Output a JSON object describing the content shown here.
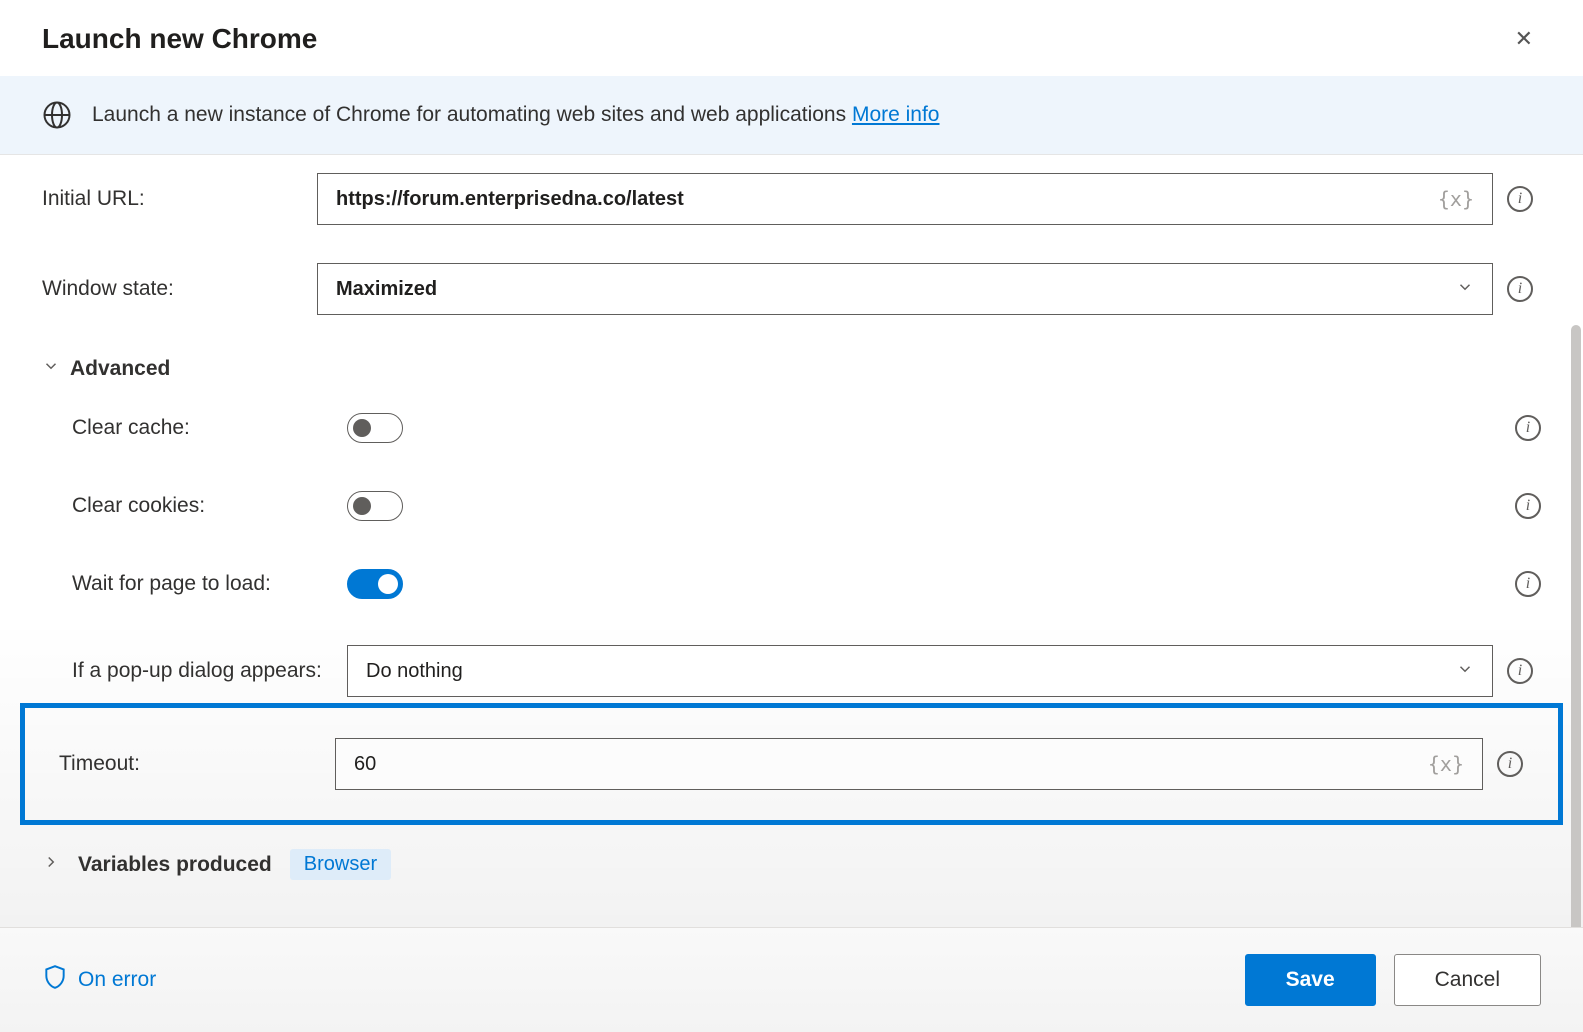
{
  "dialog": {
    "title": "Launch new Chrome",
    "close_tooltip": "Close"
  },
  "banner": {
    "text": "Launch a new instance of Chrome for automating web sites and web applications ",
    "link": "More info"
  },
  "fields": {
    "initial_url": {
      "label": "Initial URL:",
      "value": "https://forum.enterprisedna.co/latest"
    },
    "window_state": {
      "label": "Window state:",
      "value": "Maximized"
    },
    "advanced_header": "Advanced",
    "clear_cache": {
      "label": "Clear cache:",
      "on": false
    },
    "clear_cookies": {
      "label": "Clear cookies:",
      "on": false
    },
    "wait_for_load": {
      "label": "Wait for page to load:",
      "on": true
    },
    "popup": {
      "label": "If a pop-up dialog appears:",
      "value": "Do nothing"
    },
    "timeout": {
      "label": "Timeout:",
      "value": "60"
    }
  },
  "variables": {
    "header": "Variables produced",
    "chip": "Browser"
  },
  "footer": {
    "on_error": "On error",
    "save": "Save",
    "cancel": "Cancel"
  },
  "var_badge": "{x}"
}
